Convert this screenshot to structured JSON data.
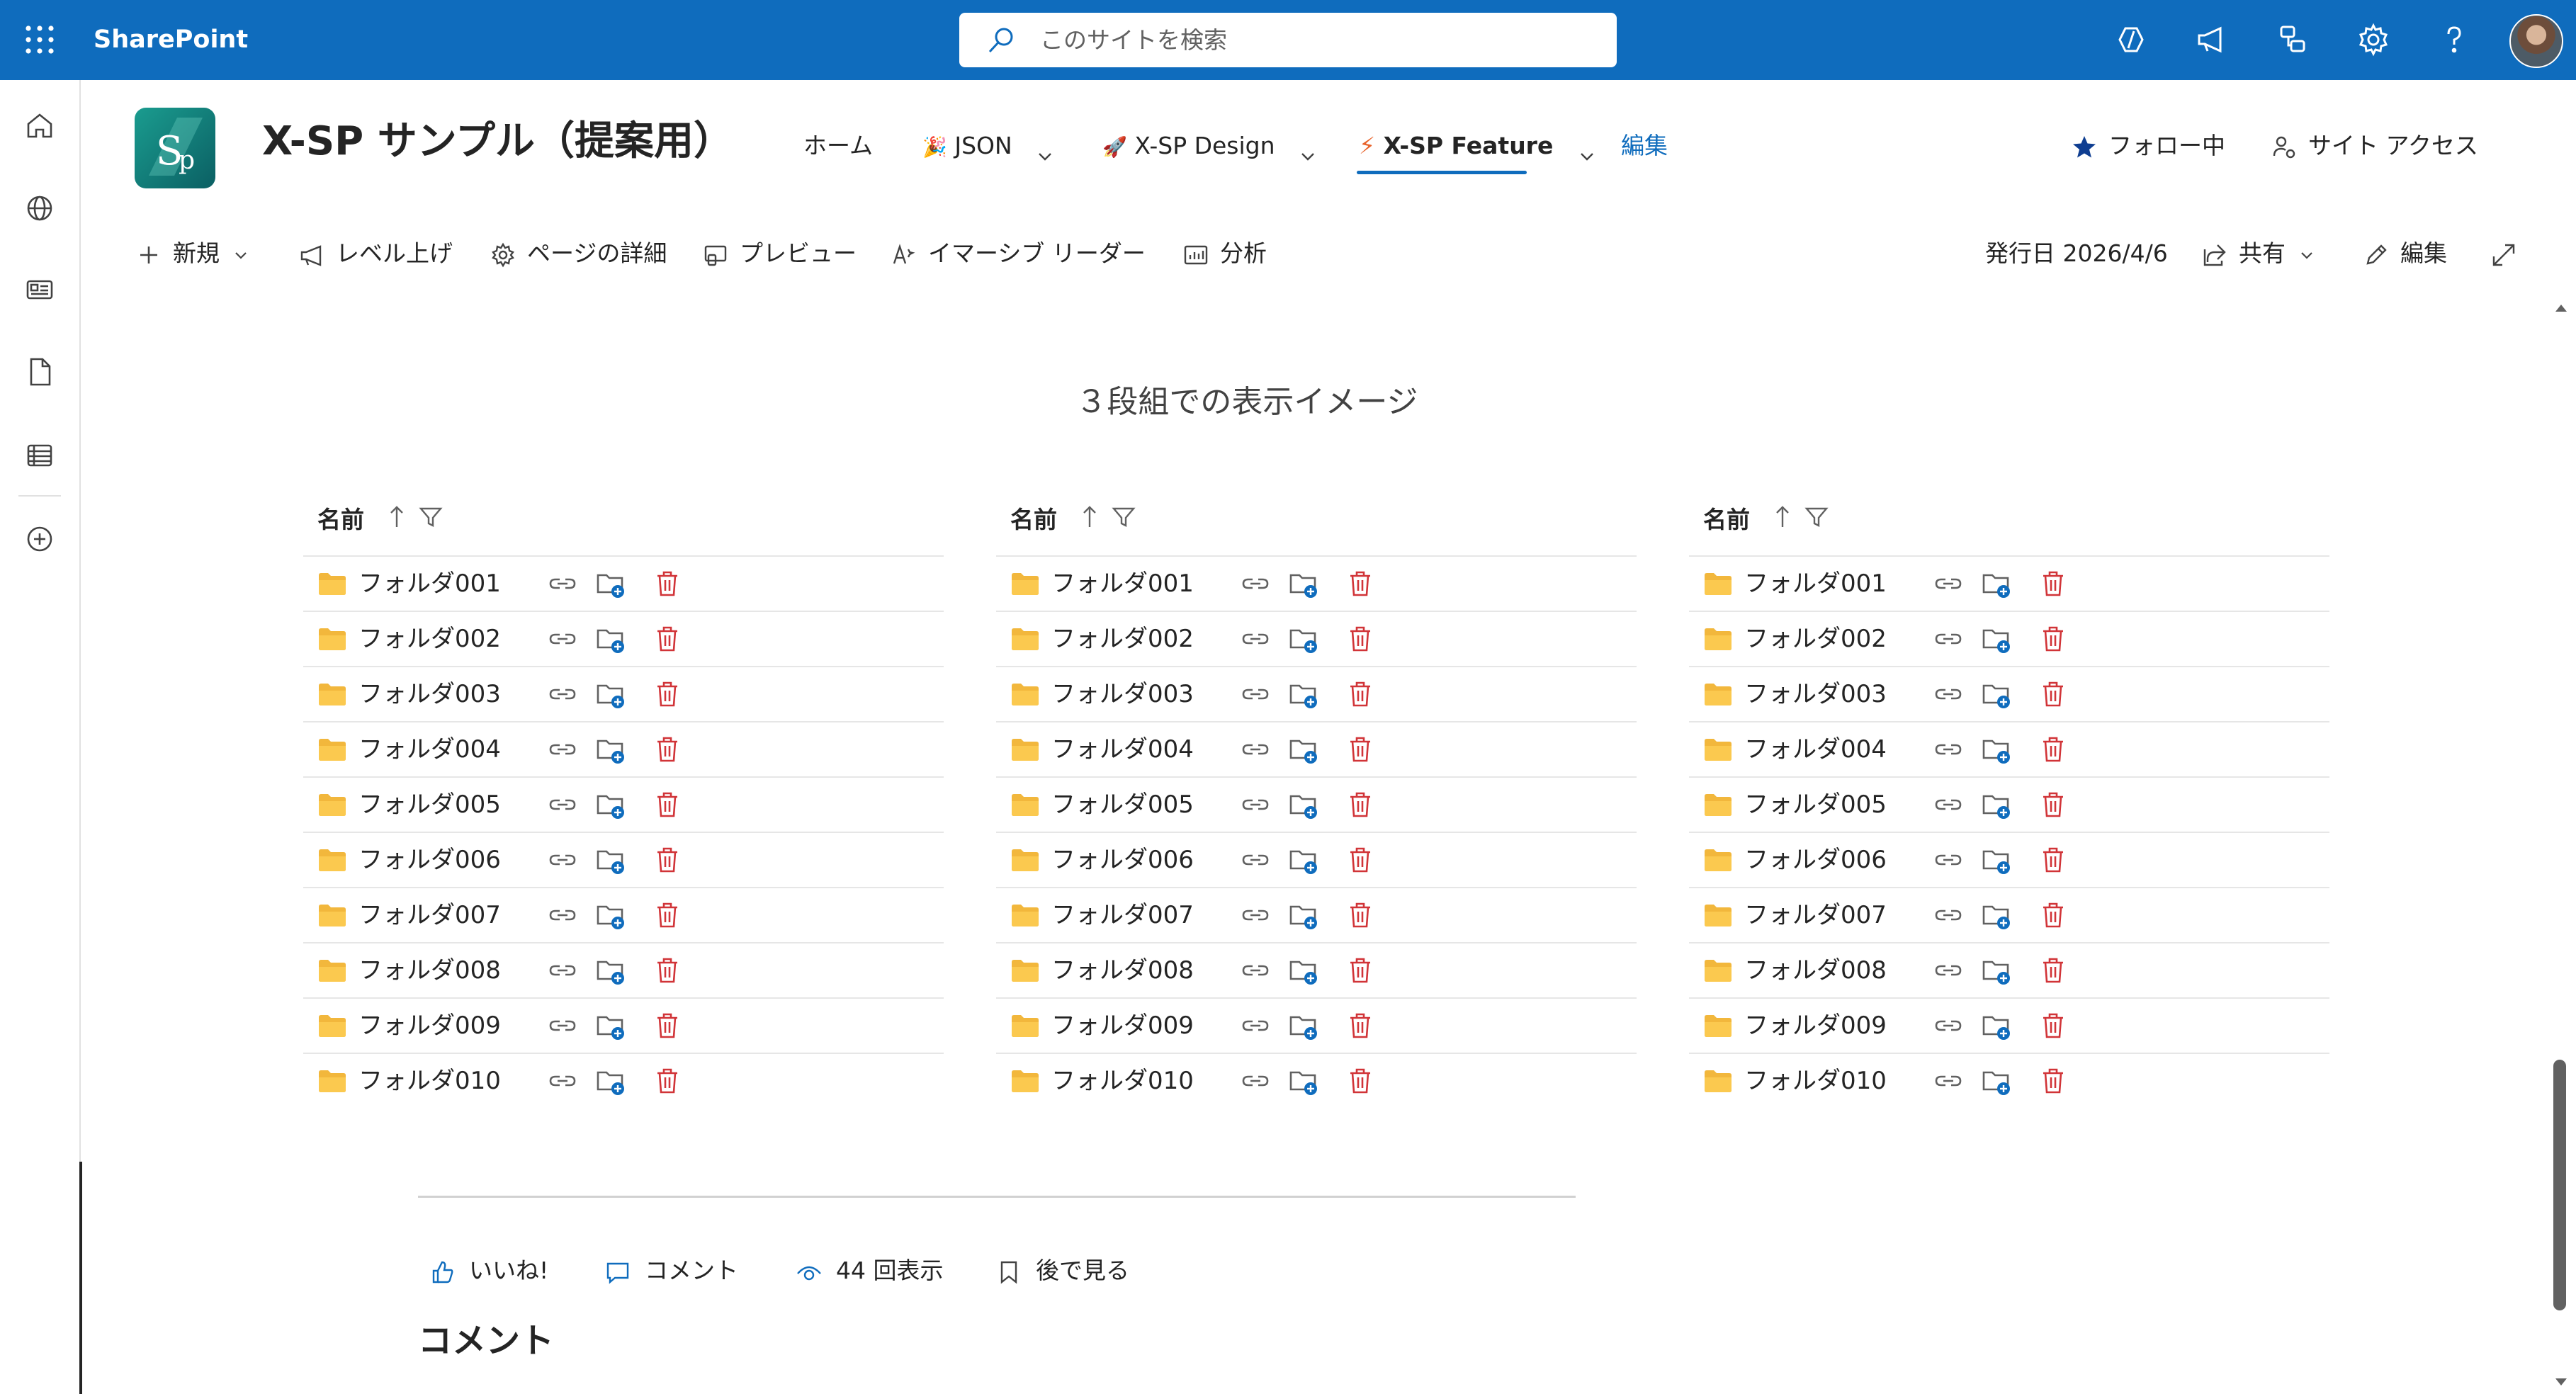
{
  "suite": {
    "brand": "SharePoint",
    "search_placeholder": "このサイトを検索"
  },
  "site": {
    "title": "X-SP サンプル（提案用）",
    "nav": [
      {
        "label": "ホーム",
        "icon": ""
      },
      {
        "label": "JSON",
        "icon": "party-popper-emoji"
      },
      {
        "label": "X-SP Design",
        "icon": "rocket-emoji"
      },
      {
        "label": "X-SP Feature",
        "icon": "lightning-emoji",
        "active": true
      },
      {
        "label": "編集"
      }
    ],
    "follow": "フォロー中",
    "site_access": "サイト アクセス"
  },
  "commandbar": {
    "new": "新規",
    "promote": "レベル上げ",
    "page_details": "ページの詳細",
    "preview": "プレビュー",
    "immersive_reader": "イマーシブ リーダー",
    "analytics": "分析",
    "published": "発行日 2026/4/6",
    "share": "共有",
    "edit": "編集"
  },
  "content": {
    "heading": "３段組での表示イメージ",
    "column_header": "名前",
    "folders": [
      "フォルダ001",
      "フォルダ002",
      "フォルダ003",
      "フォルダ004",
      "フォルダ005",
      "フォルダ006",
      "フォルダ007",
      "フォルダ008",
      "フォルダ009",
      "フォルダ010"
    ],
    "colors": {
      "folder": "#f2b73c",
      "delete": "#d13438",
      "accent": "#0f6cbd"
    }
  },
  "footer": {
    "like": "いいね!",
    "comment": "コメント",
    "views": "44 回表示",
    "save_for_later": "後で見る",
    "comments_title": "コメント"
  }
}
